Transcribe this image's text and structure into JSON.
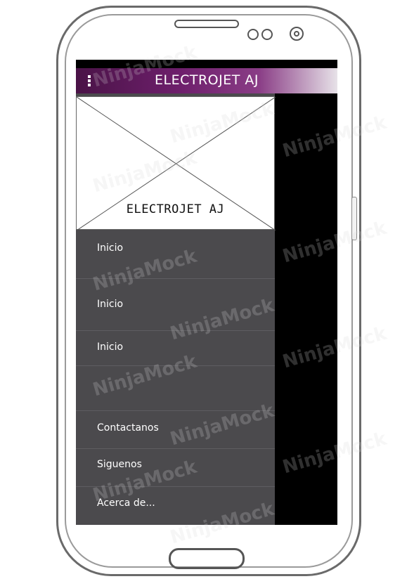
{
  "app": {
    "title": "ELECTROJET AJ"
  },
  "drawer": {
    "header_label": "ELECTROJET AJ",
    "items": [
      {
        "label": "Inicio"
      },
      {
        "label": "Inicio"
      },
      {
        "label": "Inicio"
      },
      {
        "label": ""
      },
      {
        "label": "Contactanos"
      },
      {
        "label": "Siguenos"
      },
      {
        "label": "Acerca de..."
      }
    ]
  },
  "watermark": "NinjaMock",
  "colors": {
    "appbar_start": "#4a1347",
    "appbar_end": "#e7e2e8",
    "drawer_bg": "#4b4a4d",
    "screen_bg": "#000000"
  },
  "icons": {
    "menu": "overflow-menu-icon",
    "placeholder": "image-placeholder-icon"
  }
}
